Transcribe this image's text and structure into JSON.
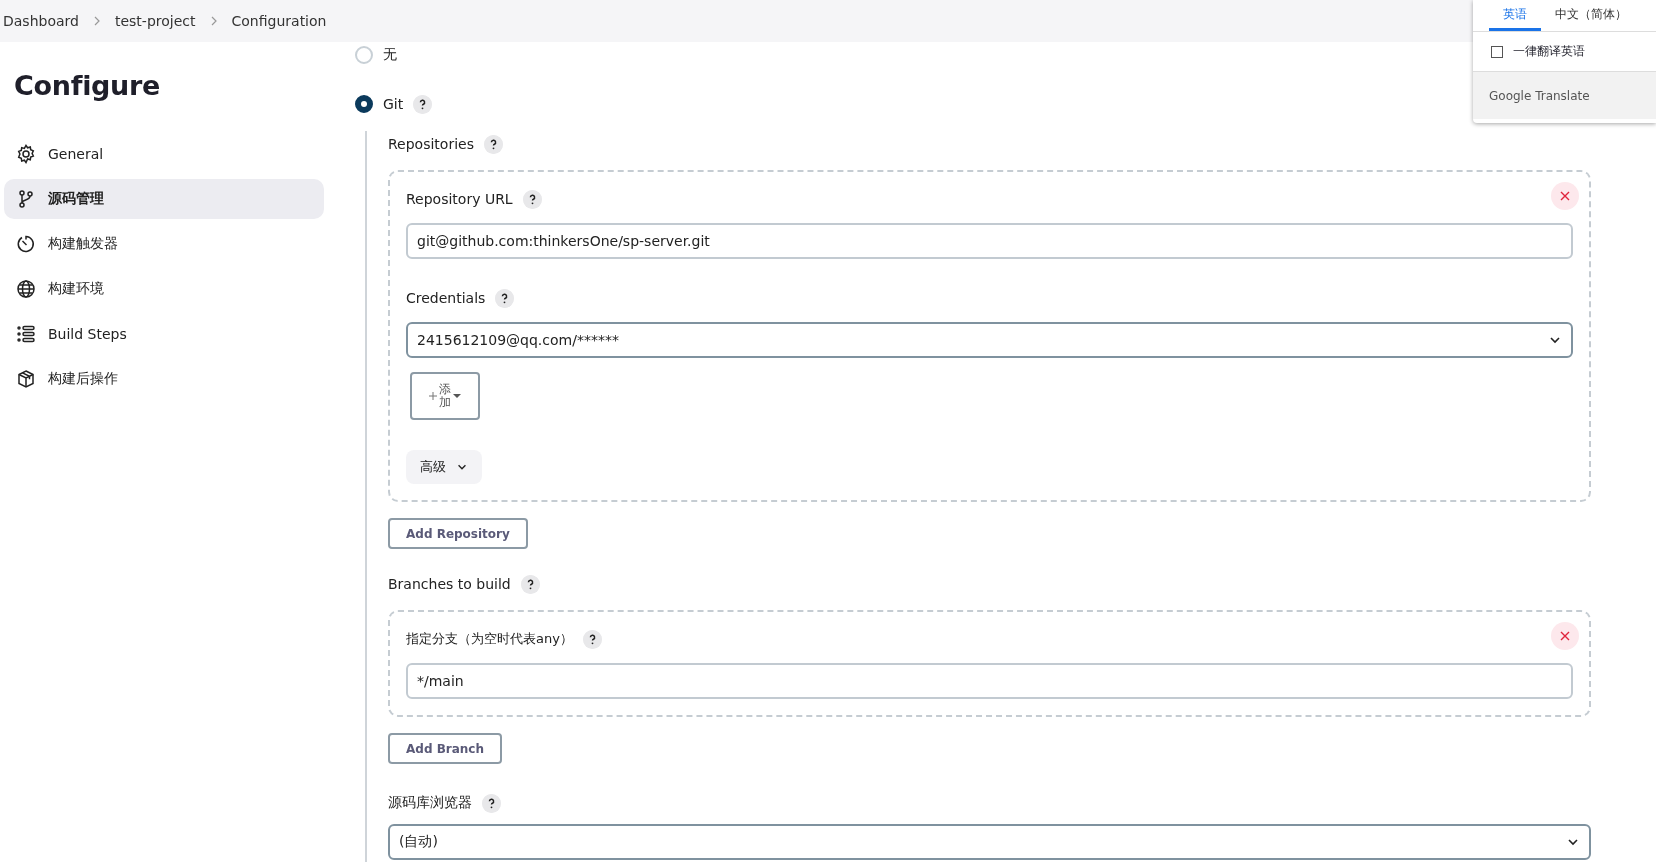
{
  "breadcrumbs": [
    "Dashboard",
    "test-project",
    "Configuration"
  ],
  "sidebar": {
    "title": "Configure",
    "items": [
      {
        "label": "General",
        "kind": "gear",
        "selected": false
      },
      {
        "label": "源码管理",
        "kind": "branch",
        "selected": true
      },
      {
        "label": "构建触发器",
        "kind": "timer",
        "selected": false
      },
      {
        "label": "构建环境",
        "kind": "globe",
        "selected": false
      },
      {
        "label": "Build Steps",
        "kind": "list",
        "selected": false
      },
      {
        "label": "构建后操作",
        "kind": "package",
        "selected": false
      }
    ]
  },
  "scm_options": [
    {
      "label": "无",
      "selected": false,
      "help": false
    },
    {
      "label": "Git",
      "selected": true,
      "help": true
    }
  ],
  "repositories": {
    "label": "Repositories",
    "entries": [
      {
        "url_label": "Repository URL",
        "url": "git@github.com:thinkersOne/sp-server.git",
        "credentials_label": "Credentials",
        "credentials": "2415612109@qq.com/******",
        "add_button": "添加",
        "advanced": "高级"
      }
    ],
    "add_button": "Add Repository"
  },
  "branches": {
    "label": "Branches to build",
    "entries": [
      {
        "label": "指定分支（为空时代表any）",
        "value": "*/main"
      }
    ],
    "add_button": "Add Branch"
  },
  "browser": {
    "label": "源码库浏览器",
    "value": "(自动)"
  },
  "translate_popup": {
    "tabs": [
      {
        "label": "英语",
        "selected": true
      },
      {
        "label": "中文（简体）",
        "selected": false
      }
    ],
    "checkbox": {
      "label": "一律翻译英语",
      "checked": false
    },
    "footer": "Google Translate"
  }
}
